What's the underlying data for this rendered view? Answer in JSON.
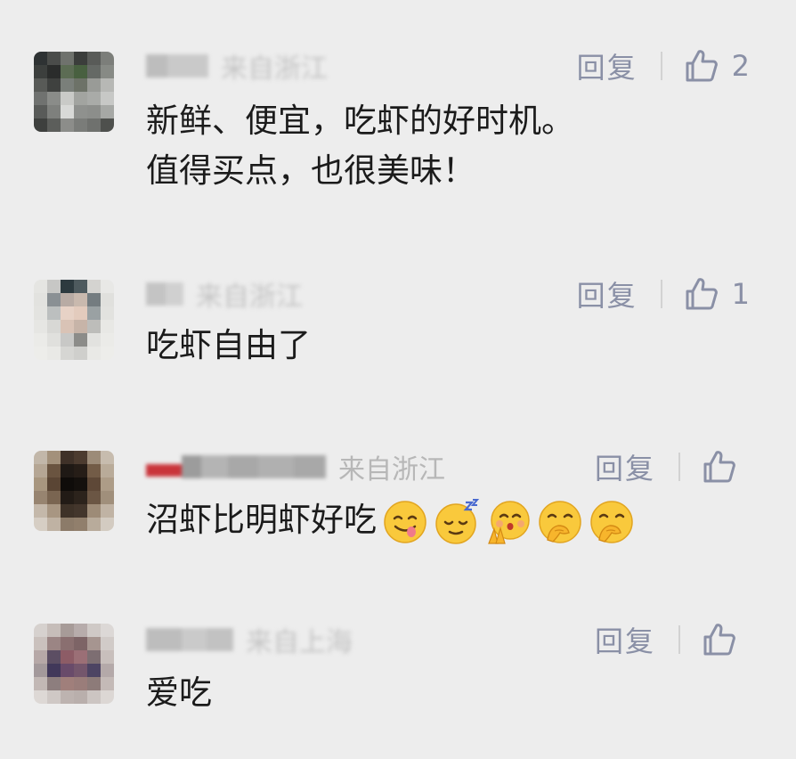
{
  "comments": [
    {
      "name_masked": "某某",
      "location": "来自浙江",
      "location_faded": true,
      "reply_label": "回复",
      "likes": "2",
      "lines": [
        "新鲜、便宜，吃虾的好时机。",
        "值得买点，也很美味！"
      ],
      "avatar_colors": [
        "#2e3233",
        "#4a4c4a",
        "#6f726d",
        "#3b3d3b",
        "#595b58",
        "#7c7e7a",
        "#3c3f3d",
        "#2a2c2b",
        "#5c6c54",
        "#486040",
        "#656965",
        "#878a85",
        "#585a57",
        "#3f413f",
        "#7a7f7a",
        "#6d7268",
        "#999b97",
        "#b7b8b5",
        "#707270",
        "#8a8c89",
        "#c9cac7",
        "#a2a4a0",
        "#a9aba8",
        "#c7c8c6",
        "#595b59",
        "#7e807d",
        "#d8d9d7",
        "#8f918e",
        "#8c8e8b",
        "#a6a8a5",
        "#3e403e",
        "#5c5e5b",
        "#8c8d8a",
        "#7a7c79",
        "#6f716e",
        "#4e504d"
      ]
    },
    {
      "name_masked": "某某",
      "location": "来自浙江",
      "location_faded": true,
      "reply_label": "回复",
      "likes": "1",
      "lines": [
        "吃虾自由了"
      ],
      "avatar_colors": [
        "#e5e5e2",
        "#c7c7c5",
        "#2d3a3f",
        "#4e5a5e",
        "#d4d3d0",
        "#e8e8e6",
        "#e2e2df",
        "#8a9094",
        "#b8aba4",
        "#c9b9ae",
        "#747c80",
        "#e0e0dd",
        "#e3e3e0",
        "#bcbfbf",
        "#e7d2c6",
        "#e3cbbd",
        "#9aa1a3",
        "#e2e2df",
        "#e6e6e3",
        "#d8d8d5",
        "#d9c3b6",
        "#c7b4a8",
        "#bdbdba",
        "#e8e8e5",
        "#ebebe8",
        "#e0e0dd",
        "#c8c8c6",
        "#8c8c89",
        "#e2e2df",
        "#ebebe8",
        "#ededea",
        "#e9e9e6",
        "#d6d6d3",
        "#cfcfcc",
        "#e9e9e6",
        "#ededea"
      ]
    },
    {
      "name_masked": "某某某某",
      "location": "来自浙江",
      "location_faded": false,
      "reply_label": "回复",
      "likes": "",
      "lines": [
        "沼虾比明虾好吃"
      ],
      "emojis": [
        "yummy-emoji-icon",
        "sleepy-emoji-icon",
        "grateful-emoji-icon",
        "giggle-emoji-icon",
        "giggle-emoji-icon"
      ],
      "avatar_colors": [
        "#c2b7a9",
        "#a3917b",
        "#3f3128",
        "#4c3b2f",
        "#9c8b78",
        "#c7bcae",
        "#b5a694",
        "#6a5440",
        "#1f1915",
        "#261d17",
        "#735c47",
        "#b9ab99",
        "#a8967f",
        "#5a4534",
        "#0f0c0a",
        "#14100d",
        "#5e4837",
        "#ad9c87",
        "#978470",
        "#7a6551",
        "#221b16",
        "#2c231c",
        "#6b5644",
        "#a08f7b",
        "#c4b8aa",
        "#a89682",
        "#3e3228",
        "#43362c",
        "#9d8b77",
        "#c0b3a4",
        "#d6cec4",
        "#bfb2a3",
        "#8c7b69",
        "#917f6c",
        "#b8ab9b",
        "#d3cbc1"
      ]
    },
    {
      "name_masked": "某某某",
      "location": "来自上海",
      "location_faded": true,
      "reply_label": "回复",
      "likes": "",
      "lines": [
        "爱吃"
      ],
      "avatar_colors": [
        "#d6d1ce",
        "#c6bdb9",
        "#a79b98",
        "#b7acab",
        "#cfc9c6",
        "#dcd8d6",
        "#cac1bd",
        "#9b8584",
        "#8a6f70",
        "#7d6466",
        "#a69590",
        "#d1cbc8",
        "#b6a8a7",
        "#5c4e63",
        "#8d5c66",
        "#9b6f76",
        "#7d6e72",
        "#c8bfbc",
        "#a3999b",
        "#41385a",
        "#694b6a",
        "#74566c",
        "#4d4463",
        "#b4a9a9",
        "#c2b8b5",
        "#8d7e7e",
        "#a07f7b",
        "#9a7d7a",
        "#8d7b79",
        "#c4bab7",
        "#ddd8d5",
        "#cfc8c5",
        "#bdb3b0",
        "#b9afac",
        "#ccc5c2",
        "#dcd7d4"
      ]
    }
  ]
}
